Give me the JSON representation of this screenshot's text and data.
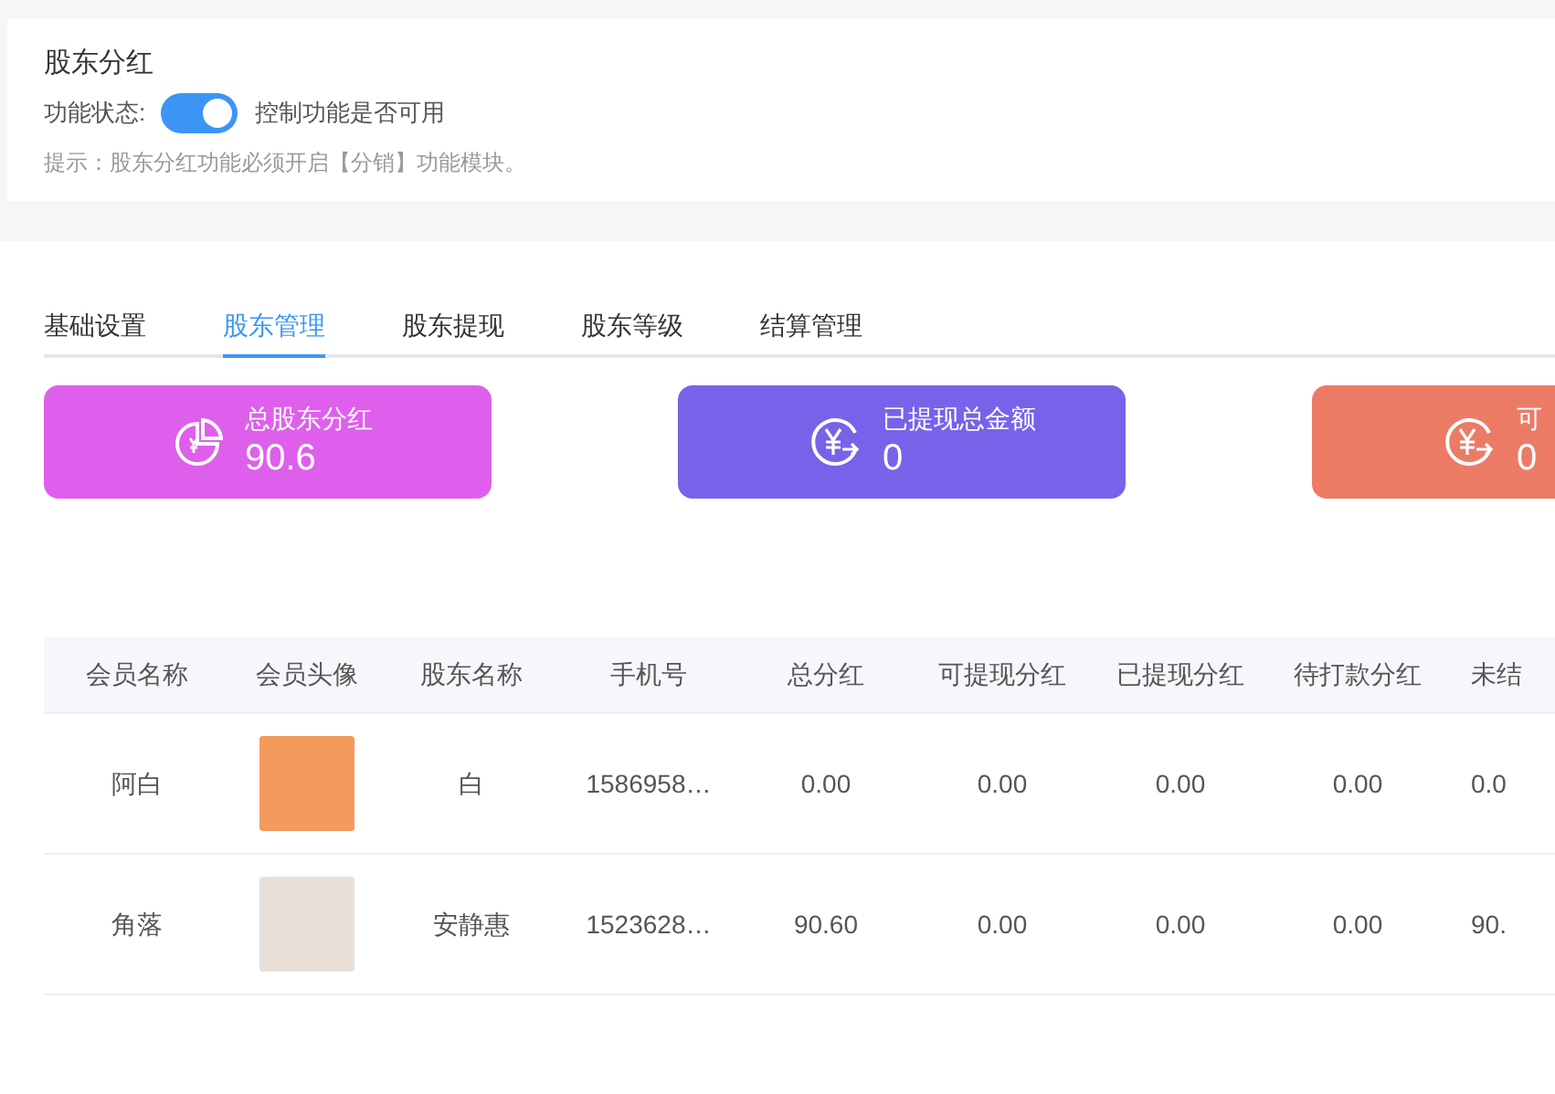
{
  "header": {
    "title": "股东分红",
    "status_label": "功能状态:",
    "status": {
      "on": true
    },
    "status_hint": "控制功能是否可用",
    "tip": "提示：股东分红功能必须开启【分销】功能模块。"
  },
  "tabs": [
    {
      "label": "基础设置",
      "selected": false
    },
    {
      "label": "股东管理",
      "selected": true
    },
    {
      "label": "股东提现",
      "selected": false
    },
    {
      "label": "股东等级",
      "selected": false
    },
    {
      "label": "结算管理",
      "selected": false
    }
  ],
  "stat_cards": [
    {
      "label": "总股东分红",
      "value": "90.6",
      "color": "#de5fec"
    },
    {
      "label": "已提现总金额",
      "value": "0",
      "color": "#7763e9"
    },
    {
      "label": "可",
      "value": "0",
      "color": "#ec7b66"
    }
  ],
  "table": {
    "columns": [
      "会员名称",
      "会员头像",
      "股东名称",
      "手机号",
      "总分红",
      "可提现分红",
      "已提现分红",
      "待打款分红",
      "未结"
    ],
    "rows": [
      {
        "cells": [
          "阿白",
          "",
          "白",
          "1586958…",
          "0.00",
          "0.00",
          "0.00",
          "0.00",
          "0.0"
        ]
      },
      {
        "cells": [
          "角落",
          "",
          "安静惠",
          "1523628…",
          "90.60",
          "0.00",
          "0.00",
          "0.00",
          "90."
        ]
      }
    ]
  }
}
